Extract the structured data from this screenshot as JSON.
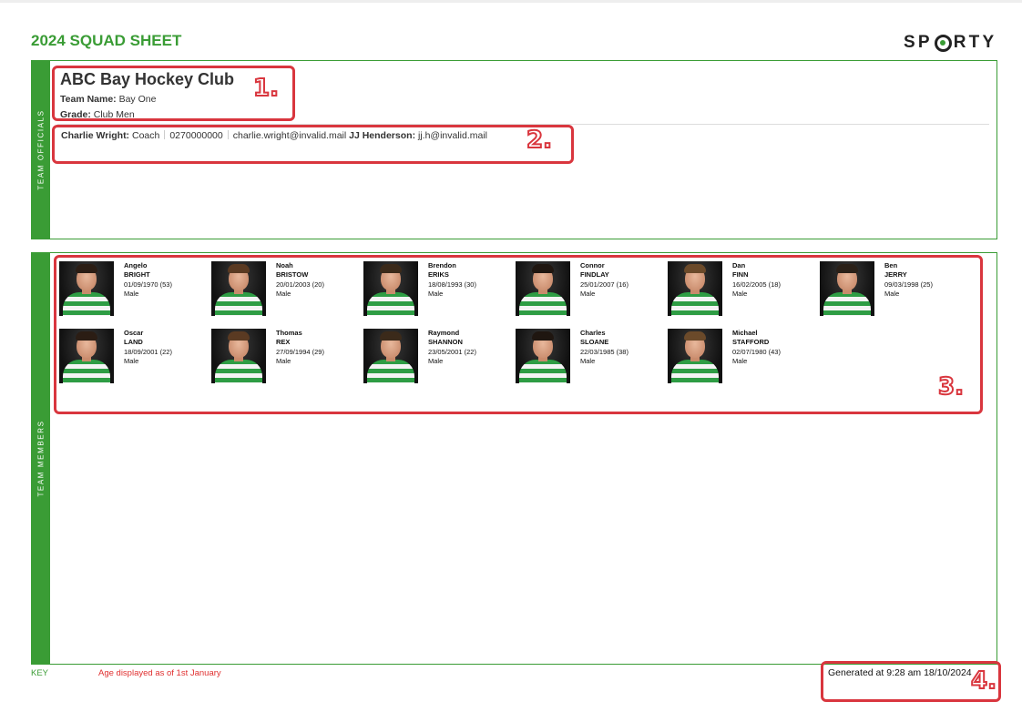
{
  "document": {
    "title": "2024 SQUAD SHEET",
    "logo_text": [
      "SP",
      "RTY"
    ],
    "accent_color": "#3a9c35",
    "annotation_color": "#d9363e"
  },
  "officials_section": {
    "side_label": "TEAM OFFICIALS",
    "club_name": "ABC Bay Hockey Club",
    "team_name_label": "Team Name:",
    "team_name": "Bay One",
    "grade_label": "Grade:",
    "grade": "Club Men",
    "officials": [
      {
        "name": "Charlie Wright:",
        "role": "Coach",
        "phone": "0270000000",
        "email": "charlie.wright@invalid.mail"
      },
      {
        "name": "JJ Henderson:",
        "email": "jj.h@invalid.mail"
      }
    ]
  },
  "members_section": {
    "side_label": "TEAM MEMBERS",
    "players": [
      {
        "first": "Angelo",
        "last": "BRIGHT",
        "dob": "01/09/1970 (53)",
        "gender": "Male"
      },
      {
        "first": "Noah",
        "last": "BRISTOW",
        "dob": "20/01/2003 (20)",
        "gender": "Male"
      },
      {
        "first": "Brendon",
        "last": "ERIKS",
        "dob": "18/08/1993 (30)",
        "gender": "Male"
      },
      {
        "first": "Connor",
        "last": "FINDLAY",
        "dob": "25/01/2007 (16)",
        "gender": "Male"
      },
      {
        "first": "Dan",
        "last": "FINN",
        "dob": "16/02/2005 (18)",
        "gender": "Male"
      },
      {
        "first": "Ben",
        "last": "JERRY",
        "dob": "09/03/1998 (25)",
        "gender": "Male"
      },
      {
        "first": "Oscar",
        "last": "LAND",
        "dob": "18/09/2001 (22)",
        "gender": "Male"
      },
      {
        "first": "Thomas",
        "last": "REX",
        "dob": "27/09/1994 (29)",
        "gender": "Male"
      },
      {
        "first": "Raymond",
        "last": "SHANNON",
        "dob": "23/05/2001 (22)",
        "gender": "Male"
      },
      {
        "first": "Charles",
        "last": "SLOANE",
        "dob": "22/03/1985 (38)",
        "gender": "Male"
      },
      {
        "first": "Michael",
        "last": "STAFFORD",
        "dob": "02/07/1980 (43)",
        "gender": "Male"
      }
    ]
  },
  "footer": {
    "key_label": "KEY",
    "age_note": "Age displayed as of 1st January",
    "generated": "Generated at 9:28 am 18/10/2024"
  },
  "annotations": [
    "1.",
    "2.",
    "3.",
    "4."
  ]
}
